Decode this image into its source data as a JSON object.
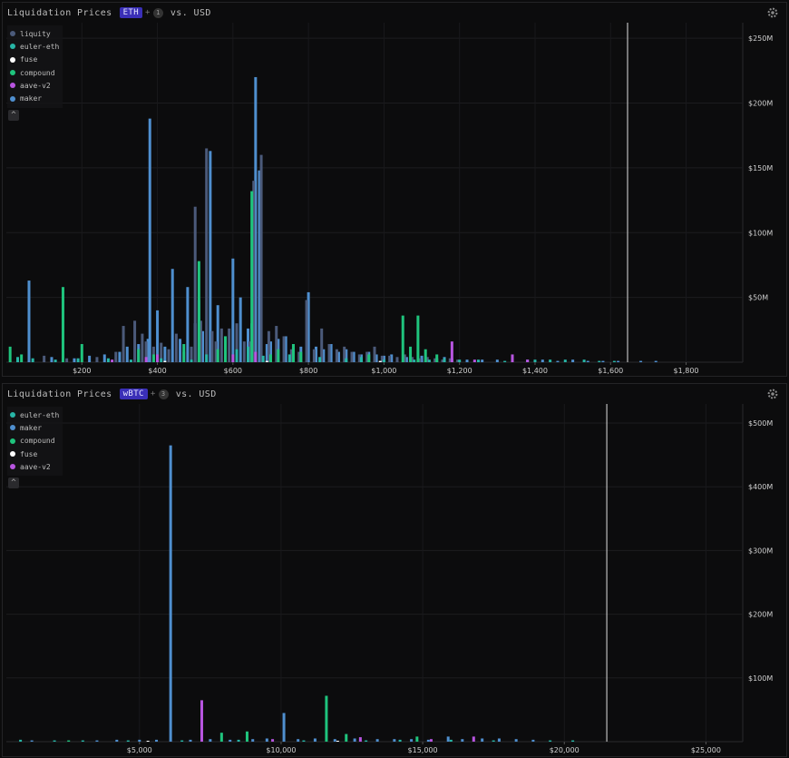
{
  "colors": {
    "liquity": "#4b5a7a",
    "euler-eth": "#27b5a6",
    "fuse": "#ffffff",
    "compound": "#1fc47d",
    "aave-v2": "#b855e0",
    "maker": "#4f8fcf"
  },
  "panels": [
    {
      "title": "Liquidation Prices",
      "token": "ETH",
      "plus": "+",
      "count": "1",
      "vs": "vs. USD",
      "legend": [
        "liquity",
        "euler-eth",
        "fuse",
        "compound",
        "aave-v2",
        "maker"
      ],
      "collapse_icon": "^"
    },
    {
      "title": "Liquidation Prices",
      "token": "wBTC",
      "plus": "+",
      "count": "3",
      "vs": "vs. USD",
      "legend": [
        "euler-eth",
        "maker",
        "compound",
        "fuse",
        "aave-v2"
      ],
      "collapse_icon": "^"
    }
  ],
  "chart_data": [
    {
      "type": "bar",
      "xlabel": "",
      "ylabel": "",
      "xlim": [
        0,
        1950
      ],
      "ylim": [
        0,
        262
      ],
      "xticks": [
        200,
        400,
        600,
        800,
        1000,
        1200,
        1400,
        1600,
        1800
      ],
      "xtick_labels": [
        "$200",
        "$400",
        "$600",
        "$800",
        "$1,000",
        "$1,200",
        "$1,400",
        "$1,600",
        "$1,800"
      ],
      "yticks": [
        50,
        100,
        150,
        200,
        250
      ],
      "ytick_labels": [
        "$50M",
        "$100M",
        "$150M",
        "$200M",
        "$250M"
      ],
      "current_price": 1645,
      "grid": true,
      "legend_position": "top-left",
      "series": [
        {
          "name": "maker",
          "points": [
            [
              60,
              63
            ],
            [
              120,
              4
            ],
            [
              180,
              3
            ],
            [
              220,
              5
            ],
            [
              260,
              6
            ],
            [
              300,
              8
            ],
            [
              320,
              12
            ],
            [
              350,
              14
            ],
            [
              375,
              18
            ],
            [
              380,
              188
            ],
            [
              400,
              40
            ],
            [
              420,
              12
            ],
            [
              440,
              72
            ],
            [
              460,
              18
            ],
            [
              480,
              58
            ],
            [
              500,
              30
            ],
            [
              510,
              48
            ],
            [
              520,
              24
            ],
            [
              540,
              163
            ],
            [
              560,
              44
            ],
            [
              580,
              20
            ],
            [
              600,
              80
            ],
            [
              620,
              50
            ],
            [
              640,
              26
            ],
            [
              650,
              30
            ],
            [
              660,
              220
            ],
            [
              670,
              148
            ],
            [
              690,
              14
            ],
            [
              700,
              16
            ],
            [
              720,
              18
            ],
            [
              740,
              20
            ],
            [
              760,
              14
            ],
            [
              780,
              12
            ],
            [
              800,
              54
            ],
            [
              820,
              12
            ],
            [
              840,
              10
            ],
            [
              860,
              14
            ],
            [
              880,
              8
            ],
            [
              900,
              10
            ],
            [
              920,
              8
            ],
            [
              940,
              6
            ],
            [
              960,
              8
            ],
            [
              980,
              6
            ],
            [
              1000,
              5
            ],
            [
              1020,
              6
            ],
            [
              1060,
              4
            ],
            [
              1100,
              5
            ],
            [
              1140,
              3
            ],
            [
              1160,
              4
            ],
            [
              1180,
              3
            ],
            [
              1220,
              2
            ],
            [
              1260,
              2
            ],
            [
              1300,
              2
            ],
            [
              1340,
              3
            ],
            [
              1380,
              2
            ],
            [
              1420,
              2
            ],
            [
              1460,
              1
            ],
            [
              1500,
              2
            ],
            [
              1540,
              1
            ],
            [
              1580,
              1
            ],
            [
              1620,
              1
            ],
            [
              1680,
              1
            ],
            [
              1720,
              1
            ]
          ]
        },
        {
          "name": "liquity",
          "points": [
            [
              100,
              5
            ],
            [
              160,
              3
            ],
            [
              240,
              4
            ],
            [
              290,
              8
            ],
            [
              310,
              28
            ],
            [
              340,
              32
            ],
            [
              360,
              22
            ],
            [
              370,
              16
            ],
            [
              390,
              12
            ],
            [
              410,
              15
            ],
            [
              430,
              10
            ],
            [
              450,
              22
            ],
            [
              470,
              8
            ],
            [
              490,
              12
            ],
            [
              500,
              120
            ],
            [
              515,
              32
            ],
            [
              530,
              165
            ],
            [
              545,
              24
            ],
            [
              555,
              16
            ],
            [
              570,
              26
            ],
            [
              590,
              26
            ],
            [
              610,
              30
            ],
            [
              630,
              16
            ],
            [
              645,
              16
            ],
            [
              655,
              140
            ],
            [
              675,
              160
            ],
            [
              695,
              24
            ],
            [
              715,
              28
            ],
            [
              735,
              20
            ],
            [
              755,
              10
            ],
            [
              775,
              8
            ],
            [
              795,
              48
            ],
            [
              815,
              10
            ],
            [
              835,
              26
            ],
            [
              855,
              14
            ],
            [
              875,
              10
            ],
            [
              895,
              12
            ],
            [
              915,
              8
            ],
            [
              935,
              6
            ],
            [
              955,
              8
            ],
            [
              975,
              12
            ],
            [
              995,
              5
            ],
            [
              1015,
              5
            ],
            [
              1035,
              4
            ],
            [
              1055,
              6
            ],
            [
              1075,
              4
            ],
            [
              1095,
              3
            ],
            [
              1115,
              4
            ],
            [
              1135,
              3
            ],
            [
              1155,
              2
            ],
            [
              1175,
              3
            ],
            [
              1195,
              2
            ]
          ]
        },
        {
          "name": "compound",
          "points": [
            [
              10,
              12
            ],
            [
              40,
              6
            ],
            [
              150,
              58
            ],
            [
              200,
              14
            ],
            [
              350,
              10
            ],
            [
              390,
              6
            ],
            [
              470,
              14
            ],
            [
              510,
              78
            ],
            [
              560,
              10
            ],
            [
              580,
              20
            ],
            [
              650,
              132
            ],
            [
              700,
              6
            ],
            [
              720,
              10
            ],
            [
              760,
              14
            ],
            [
              780,
              8
            ],
            [
              960,
              6
            ],
            [
              1050,
              36
            ],
            [
              1070,
              12
            ],
            [
              1090,
              36
            ],
            [
              1110,
              10
            ],
            [
              1140,
              6
            ]
          ]
        },
        {
          "name": "euler-eth",
          "points": [
            [
              30,
              4
            ],
            [
              70,
              3
            ],
            [
              130,
              2
            ],
            [
              190,
              3
            ],
            [
              270,
              3
            ],
            [
              330,
              2
            ],
            [
              410,
              3
            ],
            [
              490,
              2
            ],
            [
              530,
              6
            ],
            [
              610,
              10
            ],
            [
              640,
              12
            ],
            [
              680,
              5
            ],
            [
              750,
              6
            ],
            [
              830,
              4
            ],
            [
              900,
              3
            ],
            [
              940,
              4
            ],
            [
              1000,
              2
            ],
            [
              1080,
              2
            ],
            [
              1120,
              2
            ],
            [
              1160,
              3
            ],
            [
              1200,
              2
            ],
            [
              1250,
              2
            ],
            [
              1320,
              1
            ],
            [
              1400,
              2
            ],
            [
              1440,
              2
            ],
            [
              1480,
              2
            ],
            [
              1530,
              2
            ],
            [
              1570,
              1
            ],
            [
              1610,
              1
            ]
          ]
        },
        {
          "name": "aave-v2",
          "points": [
            [
              280,
              2
            ],
            [
              370,
              4
            ],
            [
              400,
              6
            ],
            [
              600,
              6
            ],
            [
              660,
              8
            ],
            [
              1180,
              16
            ],
            [
              1240,
              2
            ],
            [
              1340,
              6
            ],
            [
              1380,
              2
            ]
          ]
        },
        {
          "name": "fuse",
          "points": [
            [
              420,
              1
            ],
            [
              690,
              1
            ],
            [
              990,
              1
            ]
          ]
        }
      ]
    },
    {
      "type": "bar",
      "xlabel": "",
      "ylabel": "",
      "xlim": [
        300,
        26300
      ],
      "ylim": [
        0,
        530
      ],
      "xticks": [
        5000,
        10000,
        15000,
        20000,
        25000
      ],
      "xtick_labels": [
        "$5,000",
        "$10,000",
        "$15,000",
        "$20,000",
        "$25,000"
      ],
      "yticks": [
        100,
        200,
        300,
        400,
        500
      ],
      "ytick_labels": [
        "$100M",
        "$200M",
        "$300M",
        "$400M",
        "$500M"
      ],
      "current_price": 21500,
      "grid": true,
      "legend_position": "top-left",
      "series": [
        {
          "name": "maker",
          "points": [
            [
              1200,
              2
            ],
            [
              3500,
              2
            ],
            [
              4200,
              3
            ],
            [
              5000,
              3
            ],
            [
              5600,
              3
            ],
            [
              6100,
              465
            ],
            [
              6800,
              3
            ],
            [
              7500,
              4
            ],
            [
              8200,
              3
            ],
            [
              9000,
              4
            ],
            [
              9500,
              5
            ],
            [
              10100,
              45
            ],
            [
              10600,
              4
            ],
            [
              11200,
              5
            ],
            [
              11900,
              4
            ],
            [
              12600,
              5
            ],
            [
              13400,
              4
            ],
            [
              14000,
              4
            ],
            [
              14600,
              4
            ],
            [
              15200,
              3
            ],
            [
              15900,
              8
            ],
            [
              16400,
              4
            ],
            [
              17100,
              5
            ],
            [
              17700,
              5
            ],
            [
              18300,
              4
            ],
            [
              18900,
              3
            ]
          ]
        },
        {
          "name": "aave-v2",
          "points": [
            [
              7200,
              65
            ],
            [
              9700,
              4
            ],
            [
              12800,
              7
            ],
            [
              15300,
              4
            ],
            [
              16800,
              8
            ]
          ]
        },
        {
          "name": "compound",
          "points": [
            [
              2500,
              2
            ],
            [
              7900,
              14
            ],
            [
              8800,
              16
            ],
            [
              11600,
              72
            ],
            [
              12300,
              12
            ],
            [
              14800,
              8
            ]
          ]
        },
        {
          "name": "euler-eth",
          "points": [
            [
              800,
              3
            ],
            [
              2000,
              2
            ],
            [
              3000,
              2
            ],
            [
              4600,
              2
            ],
            [
              6500,
              2
            ],
            [
              8500,
              3
            ],
            [
              10800,
              2
            ],
            [
              13000,
              2
            ],
            [
              14200,
              3
            ],
            [
              16000,
              3
            ],
            [
              17500,
              2
            ],
            [
              19500,
              2
            ],
            [
              20300,
              2
            ]
          ]
        },
        {
          "name": "fuse",
          "points": [
            [
              5300,
              1
            ],
            [
              12000,
              1
            ]
          ]
        }
      ]
    }
  ]
}
